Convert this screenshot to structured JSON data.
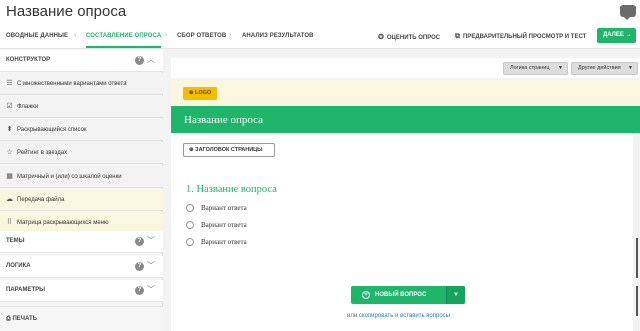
{
  "app": {
    "title": "Название опроса"
  },
  "nav": {
    "steps": [
      {
        "label": "ОВОДНЫЕ ДАННЫЕ"
      },
      {
        "label": "СОСТАВЛЕНИЕ ОПРОСА"
      },
      {
        "label": "СБОР ОТВЕТОВ"
      },
      {
        "label": "АНАЛИЗ РЕЗУЛЬТАТОВ"
      }
    ],
    "active_step": "СОСТАВЛЕНИЕ ОПРОСА",
    "rate_label": "ОЦЕНИТЬ ОПРОС",
    "preview_label": "ПРЕДВАРИТЕЛЬНЫЙ ПРОСМОТР И ТЕСТ",
    "next_label": "ДАЛЕЕ",
    "next_arrow": "→"
  },
  "sidebar": {
    "builder": {
      "label": "КОНСТРУКТОР"
    },
    "items": [
      {
        "label": "С множественными вариантами ответа",
        "icon": "list-icon",
        "glyph": "☰"
      },
      {
        "label": "Флажки",
        "icon": "checkbox-icon",
        "glyph": "☑"
      },
      {
        "label": "Раскрывающийся список",
        "icon": "dropdown-icon",
        "glyph": "⬍"
      },
      {
        "label": "Рейтинг в звездах",
        "icon": "star-icon",
        "glyph": "☆"
      },
      {
        "label": "Матричный и (или) со шкалой оценки",
        "icon": "matrix-icon",
        "glyph": "▦"
      },
      {
        "label": "Передача файла",
        "icon": "cloud-upload-icon",
        "glyph": "☁"
      },
      {
        "label": "Матрица раскрывающихся меню",
        "icon": "grid-icon",
        "glyph": "⠿"
      }
    ],
    "themes": {
      "label": "ТЕМЫ"
    },
    "logic": {
      "label": "ЛОГИКА"
    },
    "params": {
      "label": "ПАРАМЕТРЫ"
    },
    "print": {
      "label": "ПЕЧАТЬ"
    }
  },
  "toolbar": {
    "page_logic": "Логика страниц",
    "other_actions": "Другие действия"
  },
  "survey": {
    "logo_label": "LOGO",
    "title": "Название опроса",
    "page_header_label": "ЗАГОЛОВОК СТРАНИЦЫ",
    "question_title": "1. Название вопроса",
    "options": [
      "Вариант ответа",
      "Вариант ответа",
      "Вариант ответа"
    ],
    "new_question_label": "НОВЫЙ ВОПРОС",
    "or_text": "или",
    "copy_paste_link": "скопировать и вставить вопросы"
  },
  "colors": {
    "accent": "#1fb56a",
    "logo": "#f3be00",
    "highlight": "#fbf6df"
  }
}
